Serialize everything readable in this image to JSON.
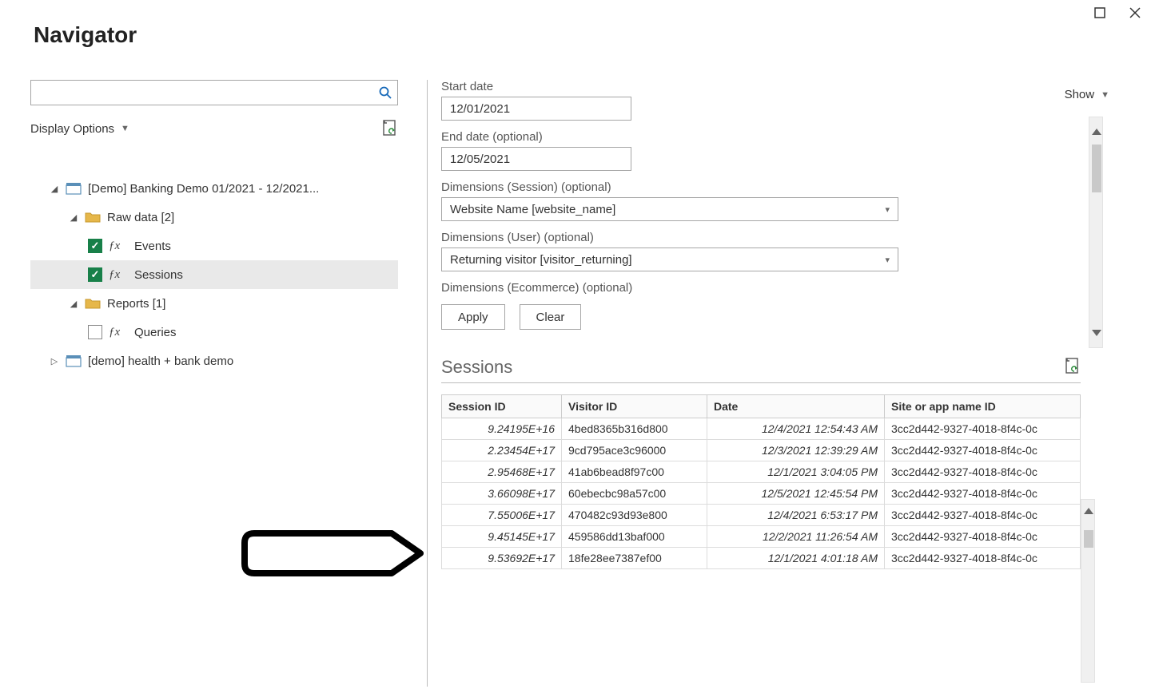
{
  "window": {
    "title": "Navigator",
    "show_label": "Show"
  },
  "left": {
    "search_placeholder": "",
    "display_options_label": "Display Options",
    "tree": {
      "node0": {
        "label": "[Demo] Banking Demo 01/2021 - 12/2021..."
      },
      "node1": {
        "label": "Raw data [2]"
      },
      "node2": {
        "label": "Events"
      },
      "node3": {
        "label": "Sessions"
      },
      "node4": {
        "label": "Reports [1]"
      },
      "node5": {
        "label": "Queries"
      },
      "node6": {
        "label": "[demo] health + bank demo"
      }
    }
  },
  "right": {
    "start_date_label": "Start date",
    "start_date_value": "12/01/2021",
    "end_date_label": "End date (optional)",
    "end_date_value": "12/05/2021",
    "dim_session_label": "Dimensions (Session) (optional)",
    "dim_session_value": "Website Name [website_name]",
    "dim_user_label": "Dimensions (User) (optional)",
    "dim_user_value": "Returning visitor [visitor_returning]",
    "dim_ecom_label": "Dimensions (Ecommerce) (optional)",
    "apply_label": "Apply",
    "clear_label": "Clear",
    "section_title": "Sessions",
    "columns": {
      "c0": "Session ID",
      "c1": "Visitor ID",
      "c2": "Date",
      "c3": "Site or app name ID"
    },
    "rows": [
      {
        "session": "9.24195E+16",
        "visitor": "4bed8365b316d800",
        "date": "12/4/2021 12:54:43 AM",
        "site": "3cc2d442-9327-4018-8f4c-0c"
      },
      {
        "session": "2.23454E+17",
        "visitor": "9cd795ace3c96000",
        "date": "12/3/2021 12:39:29 AM",
        "site": "3cc2d442-9327-4018-8f4c-0c"
      },
      {
        "session": "2.95468E+17",
        "visitor": "41ab6bead8f97c00",
        "date": "12/1/2021 3:04:05 PM",
        "site": "3cc2d442-9327-4018-8f4c-0c"
      },
      {
        "session": "3.66098E+17",
        "visitor": "60ebecbc98a57c00",
        "date": "12/5/2021 12:45:54 PM",
        "site": "3cc2d442-9327-4018-8f4c-0c"
      },
      {
        "session": "7.55006E+17",
        "visitor": "470482c93d93e800",
        "date": "12/4/2021 6:53:17 PM",
        "site": "3cc2d442-9327-4018-8f4c-0c"
      },
      {
        "session": "9.45145E+17",
        "visitor": "459586dd13baf000",
        "date": "12/2/2021 11:26:54 AM",
        "site": "3cc2d442-9327-4018-8f4c-0c"
      },
      {
        "session": "9.53692E+17",
        "visitor": "18fe28ee7387ef00",
        "date": "12/1/2021 4:01:18 AM",
        "site": "3cc2d442-9327-4018-8f4c-0c"
      }
    ]
  }
}
